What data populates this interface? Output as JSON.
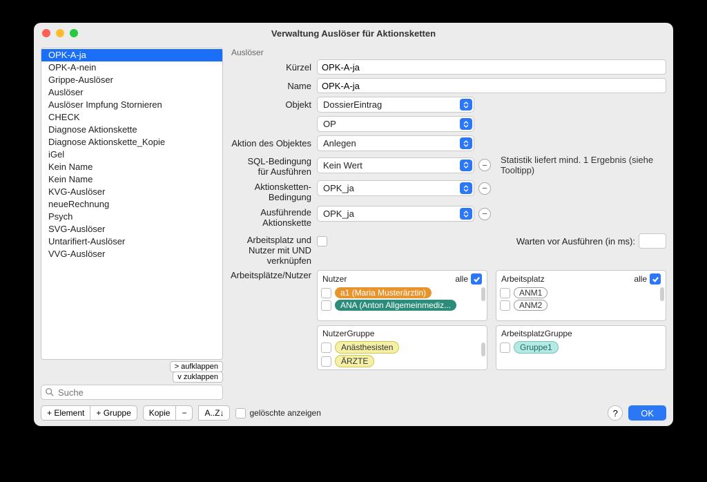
{
  "window": {
    "title": "Verwaltung Auslöser für Aktionsketten"
  },
  "sidebar": {
    "items": [
      "OPK-A-ja",
      "OPK-A-nein",
      "Grippe-Auslöser",
      "Auslöser",
      "Auslöser Impfung Stornieren",
      "CHECK",
      "Diagnose Aktionskette",
      "Diagnose Aktionskette_Kopie",
      "iGel",
      "Kein Name",
      "Kein Name",
      "KVG-Auslöser",
      "neueRechnung",
      "Psych",
      "SVG-Auslöser",
      "Untarifiert-Auslöser",
      "VVG-Auslöser"
    ],
    "selected_index": 0,
    "expand": "> aufklappen",
    "collapse": "v  zuklappen",
    "search_placeholder": "Suche"
  },
  "section_title": "Auslöser",
  "labels": {
    "kuerzel": "Kürzel",
    "name": "Name",
    "objekt": "Objekt",
    "aktion": "Aktion des Objektes",
    "sql": "SQL-Bedingung für Ausführen",
    "ak_bed": "Aktionsketten-Bedingung",
    "ak_exec": "Ausführende Aktionskette",
    "und": "Arbeitsplatz und Nutzer mit UND verknüpfen",
    "ap_nutzer": "Arbeitsplätze/Nutzer",
    "wait": "Warten vor Ausführen (in ms):",
    "sql_hint": "Statistik liefert mind. 1 Ergebnis (siehe Tooltipp)"
  },
  "values": {
    "kuerzel": "OPK-A-ja",
    "name": "OPK-A-ja",
    "objekt1": "DossierEintrag",
    "objekt2": "OP",
    "aktion": "Anlegen",
    "sql": "Kein Wert",
    "ak_bed": "OPK_ja",
    "ak_exec": "OPK_ja"
  },
  "nutzer": {
    "title": "Nutzer",
    "all": "alle",
    "items": [
      "a1 (Maria Musterärztin)",
      "ANA (Anton Allgemeinmediz..."
    ]
  },
  "arbeitsplatz": {
    "title": "Arbeitsplatz",
    "all": "alle",
    "items": [
      "ANM1",
      "ANM2"
    ]
  },
  "nutzergruppe": {
    "title": "NutzerGruppe",
    "items": [
      "Anästhesisten",
      "ÄRZTE"
    ]
  },
  "apgruppe": {
    "title": "ArbeitsplatzGruppe",
    "items": [
      "Gruppe1"
    ]
  },
  "footer": {
    "add_element": "+ Element",
    "add_group": "+ Gruppe",
    "copy": "Kopie",
    "minus": "−",
    "sort": "A..Z↓",
    "show_deleted": "gelöschte anzeigen",
    "help": "?",
    "ok": "OK"
  }
}
